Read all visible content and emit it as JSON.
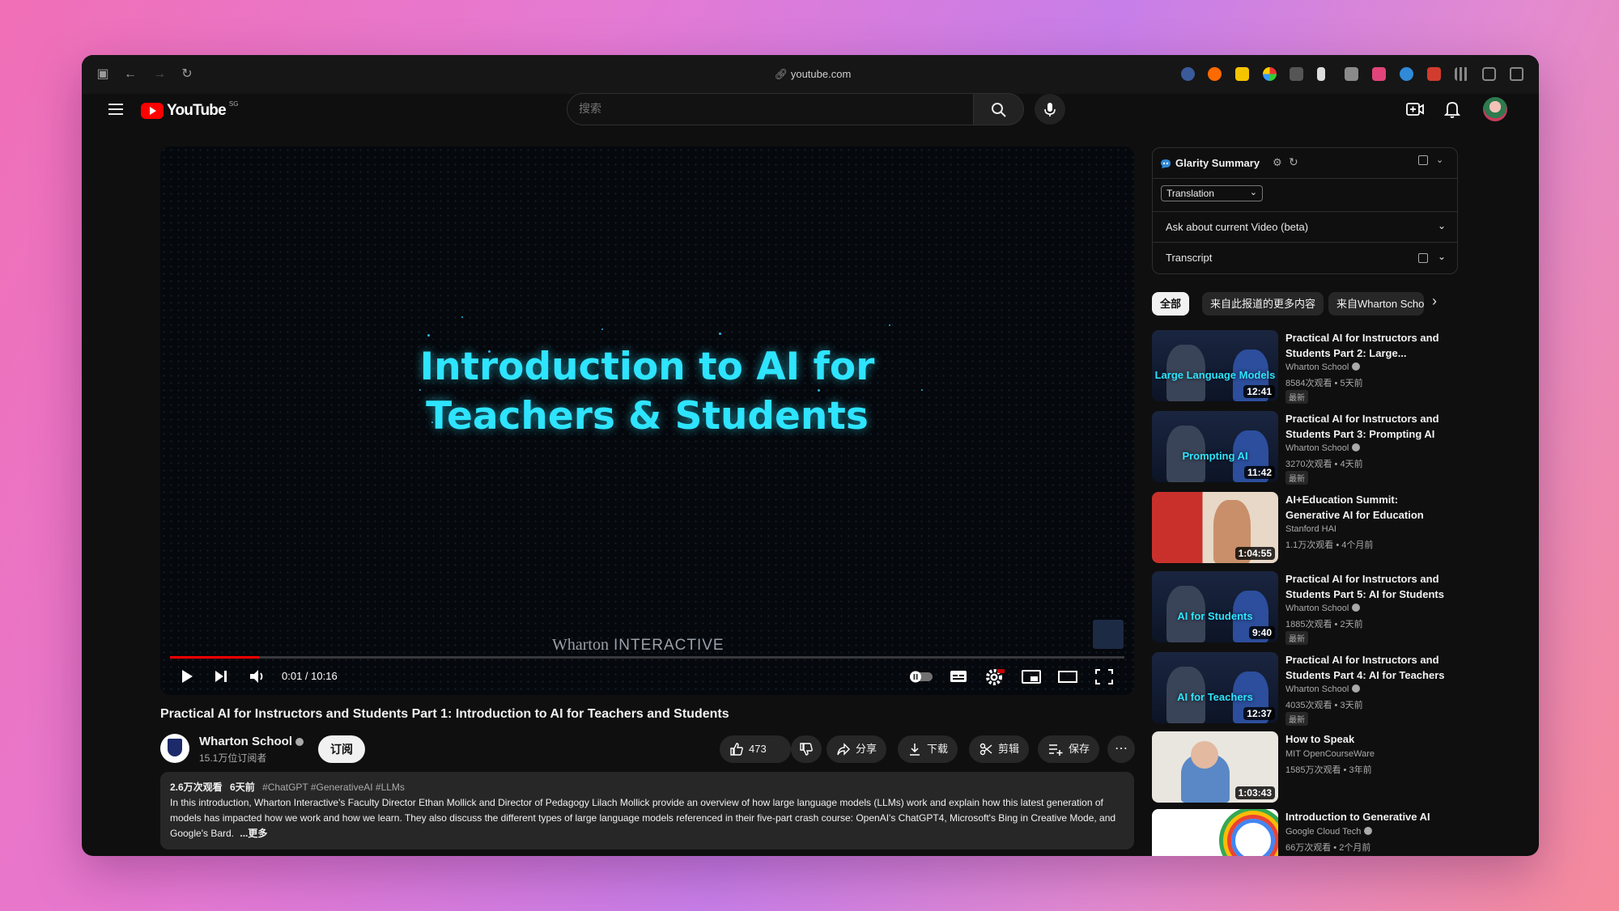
{
  "browser": {
    "url": "youtube.com"
  },
  "header": {
    "logo_text": "YouTube",
    "logo_region": "SG",
    "search_placeholder": "搜索"
  },
  "player": {
    "title_line1": "Introduction to AI for",
    "title_line2": "Teachers & Students",
    "watermark_brand": "Wharton",
    "watermark_suffix": "INTERACTIVE",
    "time": "0:01 / 10:16",
    "progress": 0.093
  },
  "video": {
    "title": "Practical AI for Instructors and Students Part 1: Introduction to AI for Teachers and Students",
    "channel": "Wharton School",
    "subscribers": "15.1万位订阅者",
    "subscribe_label": "订阅",
    "likes": "473",
    "share_label": "分享",
    "download_label": "下载",
    "clip_label": "剪辑",
    "save_label": "保存"
  },
  "description": {
    "views": "2.6万次观看",
    "age": "6天前",
    "tags": "#ChatGPT #GenerativeAI #LLMs",
    "text": "In this introduction, Wharton Interactive's Faculty Director Ethan Mollick and Director of Pedagogy Lilach Mollick provide an overview of how large language models (LLMs) work and explain how this latest generation of models has impacted how we work and how we learn. They also discuss the different types of large language models referenced in their five-part crash course: OpenAI's ChatGPT4, Microsoft's Bing in Creative Mode, and Google's Bard.",
    "more": "...更多"
  },
  "glarity": {
    "title": "Glarity Summary",
    "select_value": "Translation",
    "ask_label": "Ask about current Video (beta)",
    "transcript_label": "Transcript"
  },
  "chips": [
    "全部",
    "来自此报道的更多内容",
    "来自Wharton School"
  ],
  "recommendations": [
    {
      "title": "Practical AI for Instructors and Students Part 2: Large...",
      "channel": "Wharton School",
      "views": "8584次观看",
      "age": "5天前",
      "badge": "最新",
      "duration": "12:41",
      "caption": "Large Language Models",
      "verified": true
    },
    {
      "title": "Practical AI for Instructors and Students Part 3: Prompting AI",
      "channel": "Wharton School",
      "views": "3270次观看",
      "age": "4天前",
      "badge": "最新",
      "duration": "11:42",
      "caption": "Prompting AI",
      "verified": true
    },
    {
      "title": "AI+Education Summit: Generative AI for Education",
      "channel": "Stanford HAI",
      "views": "1.1万次观看",
      "age": "4个月前",
      "badge": "",
      "duration": "1:04:55",
      "caption": "",
      "verified": false
    },
    {
      "title": "Practical AI for Instructors and Students Part 5: AI for Students",
      "channel": "Wharton School",
      "views": "1885次观看",
      "age": "2天前",
      "badge": "最新",
      "duration": "9:40",
      "caption": "AI for Students",
      "verified": true
    },
    {
      "title": "Practical AI for Instructors and Students Part 4: AI for Teachers",
      "channel": "Wharton School",
      "views": "4035次观看",
      "age": "3天前",
      "badge": "最新",
      "duration": "12:37",
      "caption": "AI for Teachers",
      "verified": true
    },
    {
      "title": "How to Speak",
      "channel": "MIT OpenCourseWare",
      "views": "1585万次观看",
      "age": "3年前",
      "badge": "",
      "duration": "1:03:43",
      "caption": "",
      "verified": false
    },
    {
      "title": "Introduction to Generative AI",
      "channel": "Google Cloud Tech",
      "views": "66万次观看",
      "age": "2个月前",
      "badge": "",
      "duration": "",
      "caption": "",
      "verified": true
    }
  ],
  "colors": {
    "accent": "#ff0000",
    "title_glow": "#2ee4ff",
    "surface": "#272727"
  }
}
